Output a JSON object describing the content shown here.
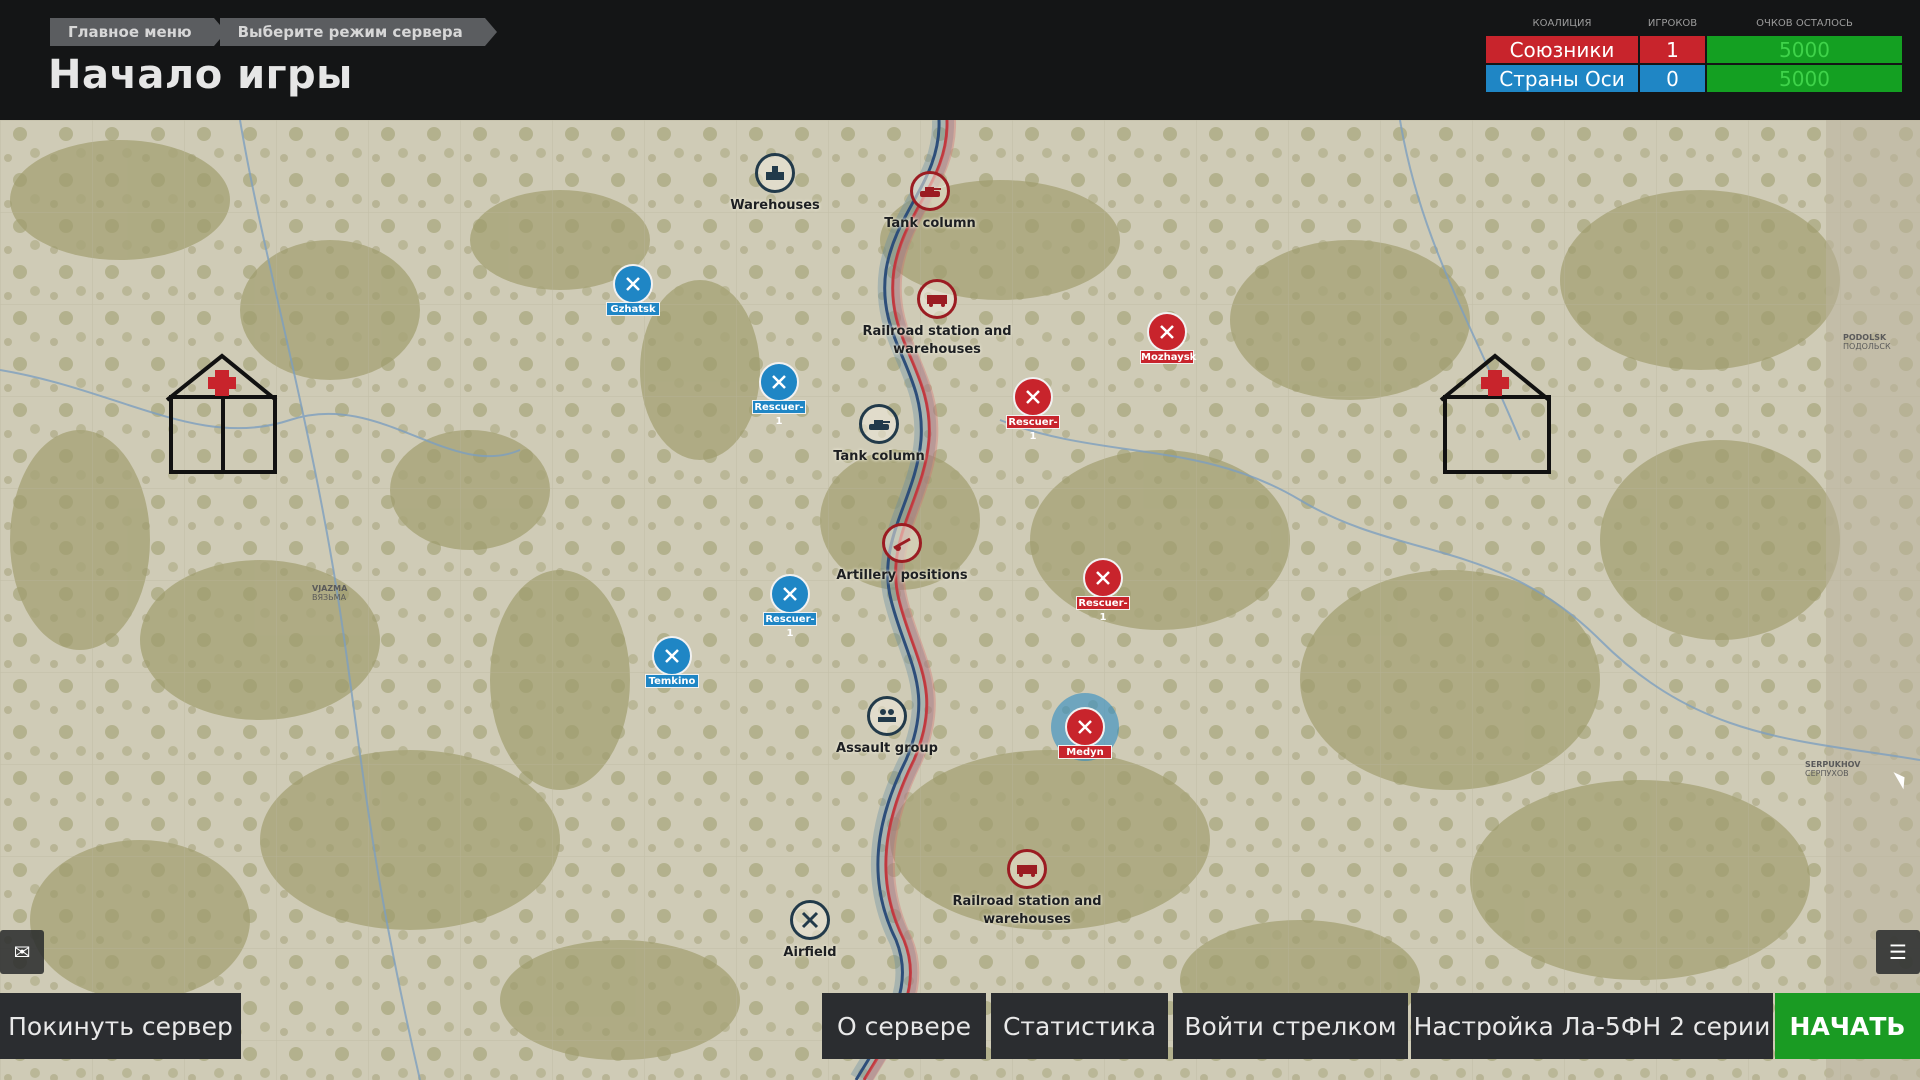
{
  "breadcrumb": [
    "Главное меню",
    "Выберите режим сервера"
  ],
  "page_title": "Начало игры",
  "scoreboard": {
    "headers": {
      "coalition": "КОАЛИЦИЯ",
      "players": "ИГРОКОВ",
      "points": "ОЧКОВ ОСТАЛОСЬ"
    },
    "rows": [
      {
        "name": "Союзники",
        "players": "1",
        "points": "5000",
        "color": "#c8242c"
      },
      {
        "name": "Страны Оси",
        "players": "0",
        "points": "5000",
        "color": "#1f86c5"
      }
    ]
  },
  "map": {
    "markers": [
      {
        "label": "Warehouses",
        "icon": "warehouse-icon"
      },
      {
        "label": "Tank column",
        "icon": "tank-icon"
      },
      {
        "label": "Gzhatsk",
        "icon": "airfield-icon"
      },
      {
        "label": "Railroad station and warehouses",
        "icon": "train-icon"
      },
      {
        "label": "Mozhaysk",
        "icon": "airfield-icon"
      },
      {
        "label": "Rescuer-1",
        "icon": "airfield-icon"
      },
      {
        "label": "Rescuer-1",
        "icon": "airfield-icon"
      },
      {
        "label": "Tank column",
        "icon": "tank-icon"
      },
      {
        "label": "Artillery positions",
        "icon": "artillery-icon"
      },
      {
        "label": "Rescuer-1",
        "icon": "airfield-icon"
      },
      {
        "label": "Rescuer-1",
        "icon": "airfield-icon"
      },
      {
        "label": "Temkino",
        "icon": "airfield-icon"
      },
      {
        "label": "Assault group",
        "icon": "assault-icon"
      },
      {
        "label": "Medyn",
        "icon": "airfield-icon"
      },
      {
        "label": "Railroad station and warehouses",
        "icon": "train-icon"
      },
      {
        "label": "Airfield",
        "icon": "airfield-icon"
      }
    ],
    "place_names": [
      "VJAZMA",
      "ВЯЗЬМА",
      "PODOLSK",
      "ПОДОЛЬСК",
      "SERPUKHOV",
      "СЕРПУХОВ"
    ]
  },
  "buttons": {
    "leave": "Покинуть сервер",
    "about": "О сервере",
    "stats": "Статистика",
    "gunner": "Войти стрелком",
    "setup": "Настройка Ла-5ФН 2 серии",
    "start": "НАЧАТЬ"
  },
  "colors": {
    "allies": "#c8242c",
    "axis": "#1f86c5",
    "start": "#1a9b23",
    "points": "#14a022"
  }
}
